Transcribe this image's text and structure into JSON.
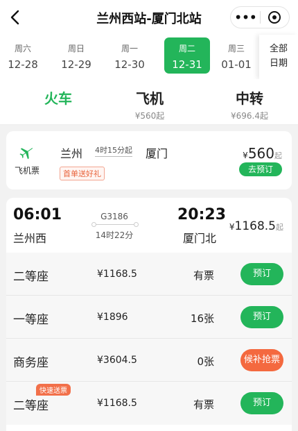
{
  "header": {
    "title": "兰州西站-厦门北站",
    "more_label": "•••"
  },
  "dates": [
    {
      "weekday": "周六",
      "date": "12-28",
      "active": false
    },
    {
      "weekday": "周日",
      "date": "12-29",
      "active": false
    },
    {
      "weekday": "周一",
      "date": "12-30",
      "active": false
    },
    {
      "weekday": "周二",
      "date": "12-31",
      "active": true
    },
    {
      "weekday": "周三",
      "date": "01-01",
      "active": false
    }
  ],
  "all_dates": {
    "line1": "全部",
    "line2": "日期"
  },
  "modes": [
    {
      "name": "火车",
      "price": "",
      "active": true
    },
    {
      "name": "飞机",
      "price": "¥560起",
      "active": false
    },
    {
      "name": "中转",
      "price": "¥696.4起",
      "active": false
    }
  ],
  "flight": {
    "label": "飞机票",
    "from": "兰州",
    "duration": "4时15分起",
    "to": "厦门",
    "promo": "首单送好礼",
    "currency": "¥",
    "price": "560",
    "qi": "起",
    "book_label": "去预订",
    "accent_color": "#23b55a"
  },
  "train": {
    "departure_time": "06:01",
    "departure_station": "兰州西",
    "train_no": "G3186",
    "duration": "14时22分",
    "arrival_time": "20:23",
    "arrival_station": "厦门北",
    "currency": "¥",
    "price": "1168.5",
    "qi": "起",
    "seats": [
      {
        "type": "二等座",
        "price": "¥1168.5",
        "stock": "有票",
        "action": "预订",
        "badge": "",
        "waitlist": false
      },
      {
        "type": "一等座",
        "price": "¥1896",
        "stock": "16张",
        "action": "预订",
        "badge": "",
        "waitlist": false
      },
      {
        "type": "商务座",
        "price": "¥3604.5",
        "stock": "0张",
        "action": "候补抢票",
        "badge": "",
        "waitlist": true
      },
      {
        "type": "二等座",
        "price": "¥1168.5",
        "stock": "有票",
        "action": "预订",
        "badge": "快速送票",
        "waitlist": false
      }
    ]
  },
  "colors": {
    "accent": "#23b55a",
    "waitlist": "#f4693f",
    "promo": "#e8623a"
  }
}
